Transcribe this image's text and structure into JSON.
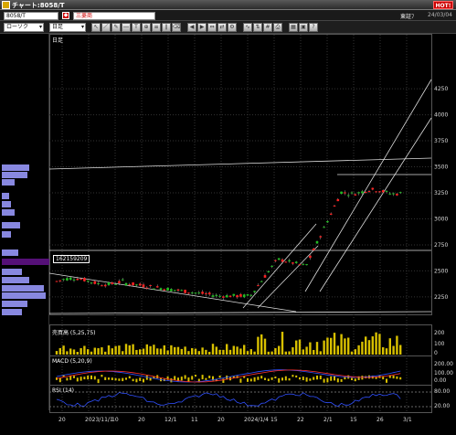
{
  "window": {
    "title": "チャート:8058/T",
    "hot_label": "HOT!"
  },
  "toolbar": {
    "code_value": "8058/T",
    "name_value": "三菱商",
    "market_label": "東証ﾌ",
    "datetime": "24/03/04",
    "candle_type": "ローソク",
    "period": "日足"
  },
  "chart": {
    "period_label": "日足",
    "y_ticks": [
      "4250",
      "4000",
      "3750",
      "3500",
      "3250",
      "3000",
      "2750",
      "2500",
      "2250"
    ],
    "x_ticks": [
      "20",
      "2023/11/1",
      "10",
      "20",
      "12/1",
      "11",
      "20",
      "2024/1/4",
      "15",
      "22",
      "2/1",
      "15",
      "26",
      "3/1"
    ],
    "price_box": "162159209",
    "volume_label": "売買高 (5,25,75)",
    "volume_ticks": [
      "200",
      "100",
      "0"
    ],
    "macd_label": "MACD (5,20,9)",
    "macd_ticks": [
      "200.00",
      "100.00",
      "0.00"
    ],
    "rsi_label": "RSI (14)",
    "rsi_ticks": [
      "80.00",
      "20.00"
    ]
  },
  "colors": {
    "up": "#ff2020",
    "down": "#20c020",
    "volume_bar": "#d8c000",
    "macd": "#3050ff",
    "signal": "#ff3030"
  }
}
